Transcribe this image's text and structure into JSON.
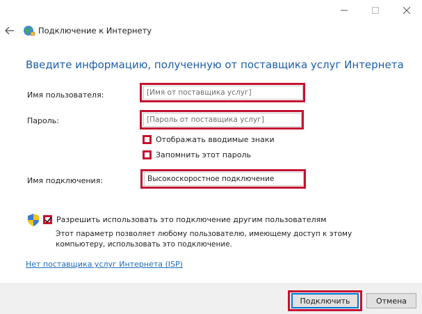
{
  "window": {
    "controls": [
      "minimize-icon",
      "maximize-icon",
      "close-icon"
    ],
    "title": "Подключение к Интернету",
    "title_icon": "globe-network-icon",
    "back_icon": "arrow-left-icon"
  },
  "heading": "Введите информацию, полученную от поставщика услуг Интернета",
  "form": {
    "username": {
      "label": "Имя пользователя:",
      "value": "",
      "placeholder": "[Имя от поставщика услуг]"
    },
    "password": {
      "label": "Пароль:",
      "value": "",
      "placeholder": "[Пароль от поставщика услуг]"
    },
    "show_chars": {
      "label": "Отображать вводимые знаки",
      "checked": false
    },
    "remember": {
      "label": "Запомнить этот пароль",
      "checked": false
    },
    "connection_name": {
      "label": "Имя подключения:",
      "value": "Высокоскоростное подключение"
    }
  },
  "share": {
    "icon": "uac-shield-icon",
    "checked": true,
    "label": "Разрешить использовать это подключение другим пользователям",
    "description": "Этот параметр позволяет любому пользователю, имеющему доступ к этому компьютеру, использовать это подключение."
  },
  "isp_link": "Нет поставщика услуг Интернета (ISP)",
  "buttons": {
    "connect": "Подключить",
    "cancel": "Отмена"
  },
  "colors": {
    "heading": "#1c5fa8",
    "link": "#1c6bbf",
    "highlight": "#c41230",
    "primary_border": "#0078d7"
  }
}
